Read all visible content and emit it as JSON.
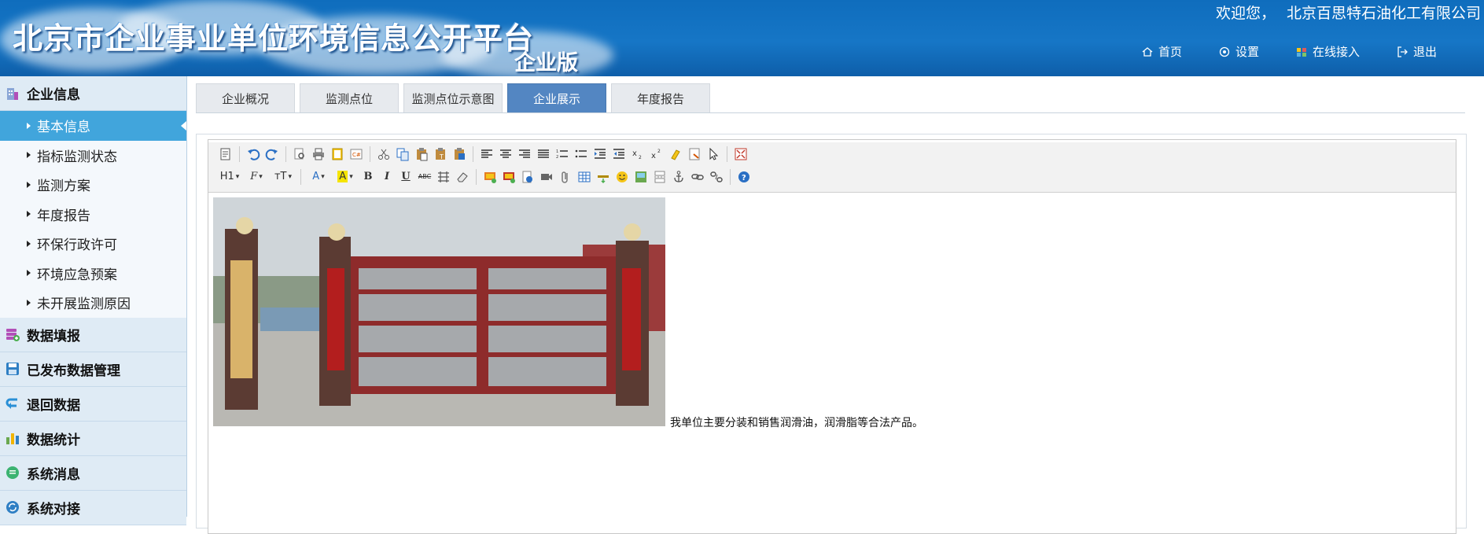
{
  "header": {
    "title": "北京市企业事业单位环境信息公开平台",
    "edition": "企业版",
    "welcome": "欢迎您，",
    "company": "北京百思特石油化工有限公司",
    "nav": [
      {
        "label": "首页",
        "icon": "home-icon"
      },
      {
        "label": "设置",
        "icon": "gear-icon"
      },
      {
        "label": "在线接入",
        "icon": "plugin-icon"
      },
      {
        "label": "退出",
        "icon": "logout-icon"
      }
    ]
  },
  "sidebar": {
    "groups": [
      {
        "label": "企业信息",
        "icon": "building-icon",
        "color": "#6b8fc9",
        "items": [
          "基本信息",
          "指标监测状态",
          "监测方案",
          "年度报告",
          "环保行政许可",
          "环境应急预案",
          "未开展监测原因"
        ],
        "active_item": "基本信息"
      },
      {
        "label": "数据填报",
        "icon": "data-entry-icon",
        "color": "#b24fb8"
      },
      {
        "label": "已发布数据管理",
        "icon": "save-icon",
        "color": "#2f7fc4"
      },
      {
        "label": "退回数据",
        "icon": "return-icon",
        "color": "#2a8fd6"
      },
      {
        "label": "数据统计",
        "icon": "bar-chart-icon",
        "color": "#6aa84f"
      },
      {
        "label": "系统消息",
        "icon": "message-icon",
        "color": "#3cb371"
      },
      {
        "label": "系统对接",
        "icon": "sync-icon",
        "color": "#2f7fc4"
      }
    ]
  },
  "tabs": [
    {
      "label": "企业概况",
      "active": false
    },
    {
      "label": "监测点位",
      "active": false
    },
    {
      "label": "监测点位示意图",
      "active": false
    },
    {
      "label": "企业展示",
      "active": true
    },
    {
      "label": "年度报告",
      "active": false
    }
  ],
  "editor": {
    "toolbar_row1": [
      "source-icon",
      "undo-icon",
      "redo-icon",
      "preview-icon",
      "print-icon",
      "template-icon",
      "code-icon",
      "cut-icon",
      "copy-icon",
      "paste-icon",
      "paste-text-icon",
      "paste-word-icon",
      "align-left-icon",
      "align-center-icon",
      "align-right-icon",
      "justify-icon",
      "ordered-list-icon",
      "unordered-list-icon",
      "indent-icon",
      "outdent-icon",
      "subscript-icon",
      "superscript-icon",
      "clear-format-icon",
      "select-all-icon",
      "cursor-icon",
      "fullscreen-icon"
    ],
    "toolbar_row2": [
      "heading-icon",
      "font-family-icon",
      "font-size-icon",
      "font-color-icon",
      "highlight-icon",
      "bold-icon",
      "italic-icon",
      "underline-icon",
      "strikethrough-icon",
      "line-height-icon",
      "eraser-icon",
      "image-icon",
      "multi-image-icon",
      "flash-icon",
      "video-icon",
      "attachment-icon",
      "table-icon",
      "horizontal-rule-icon",
      "emoticon-icon",
      "map-icon",
      "page-break-icon",
      "anchor-icon",
      "link-icon",
      "unlink-icon",
      "help-icon"
    ],
    "labels": {
      "heading": "H1",
      "font_family": "F",
      "font_size": "тT",
      "font_color": "A",
      "highlight": "A",
      "bold": "B",
      "italic": "I",
      "underline": "U",
      "strike": "ABC"
    },
    "description": "我单位主要分装和销售润滑油，润滑脂等合法产品。"
  },
  "colors": {
    "header_blue": "#1676c6",
    "active_tab": "#5386c2",
    "active_side_item": "#41a5dc",
    "sidebar_bg": "#e3eef7"
  }
}
